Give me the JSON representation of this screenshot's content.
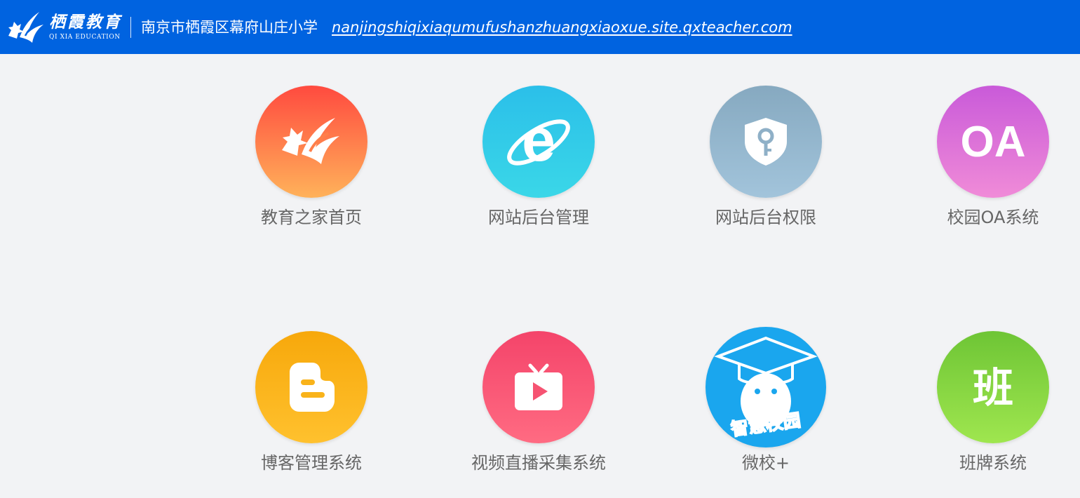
{
  "header": {
    "brand_cn": "栖霞教育",
    "brand_en": "QI XIA EDUCATION",
    "school_name": "南京市栖霞区幕府山庄小学",
    "site_url": "nanjingshiqixiaqumufushanzhuangxiaoxue.site.qxteacher.com",
    "bar_color": "#0063e0"
  },
  "apps": [
    {
      "label": "教育之家首页",
      "icon": "qixia-logo-icon"
    },
    {
      "label": "网站后台管理",
      "icon": "internet-explorer-icon"
    },
    {
      "label": "网站后台权限",
      "icon": "shield-key-icon"
    },
    {
      "label": "校园OA系统",
      "icon": "oa-icon",
      "icon_text": "OA"
    },
    {
      "label": "博客管理系统",
      "icon": "blogger-icon"
    },
    {
      "label": "视频直播采集系统",
      "icon": "tv-play-icon"
    },
    {
      "label": "微校+",
      "icon": "smart-campus-icon",
      "icon_text": "智慧校园"
    },
    {
      "label": "班牌系统",
      "icon": "class-board-icon",
      "icon_text": "班"
    }
  ]
}
